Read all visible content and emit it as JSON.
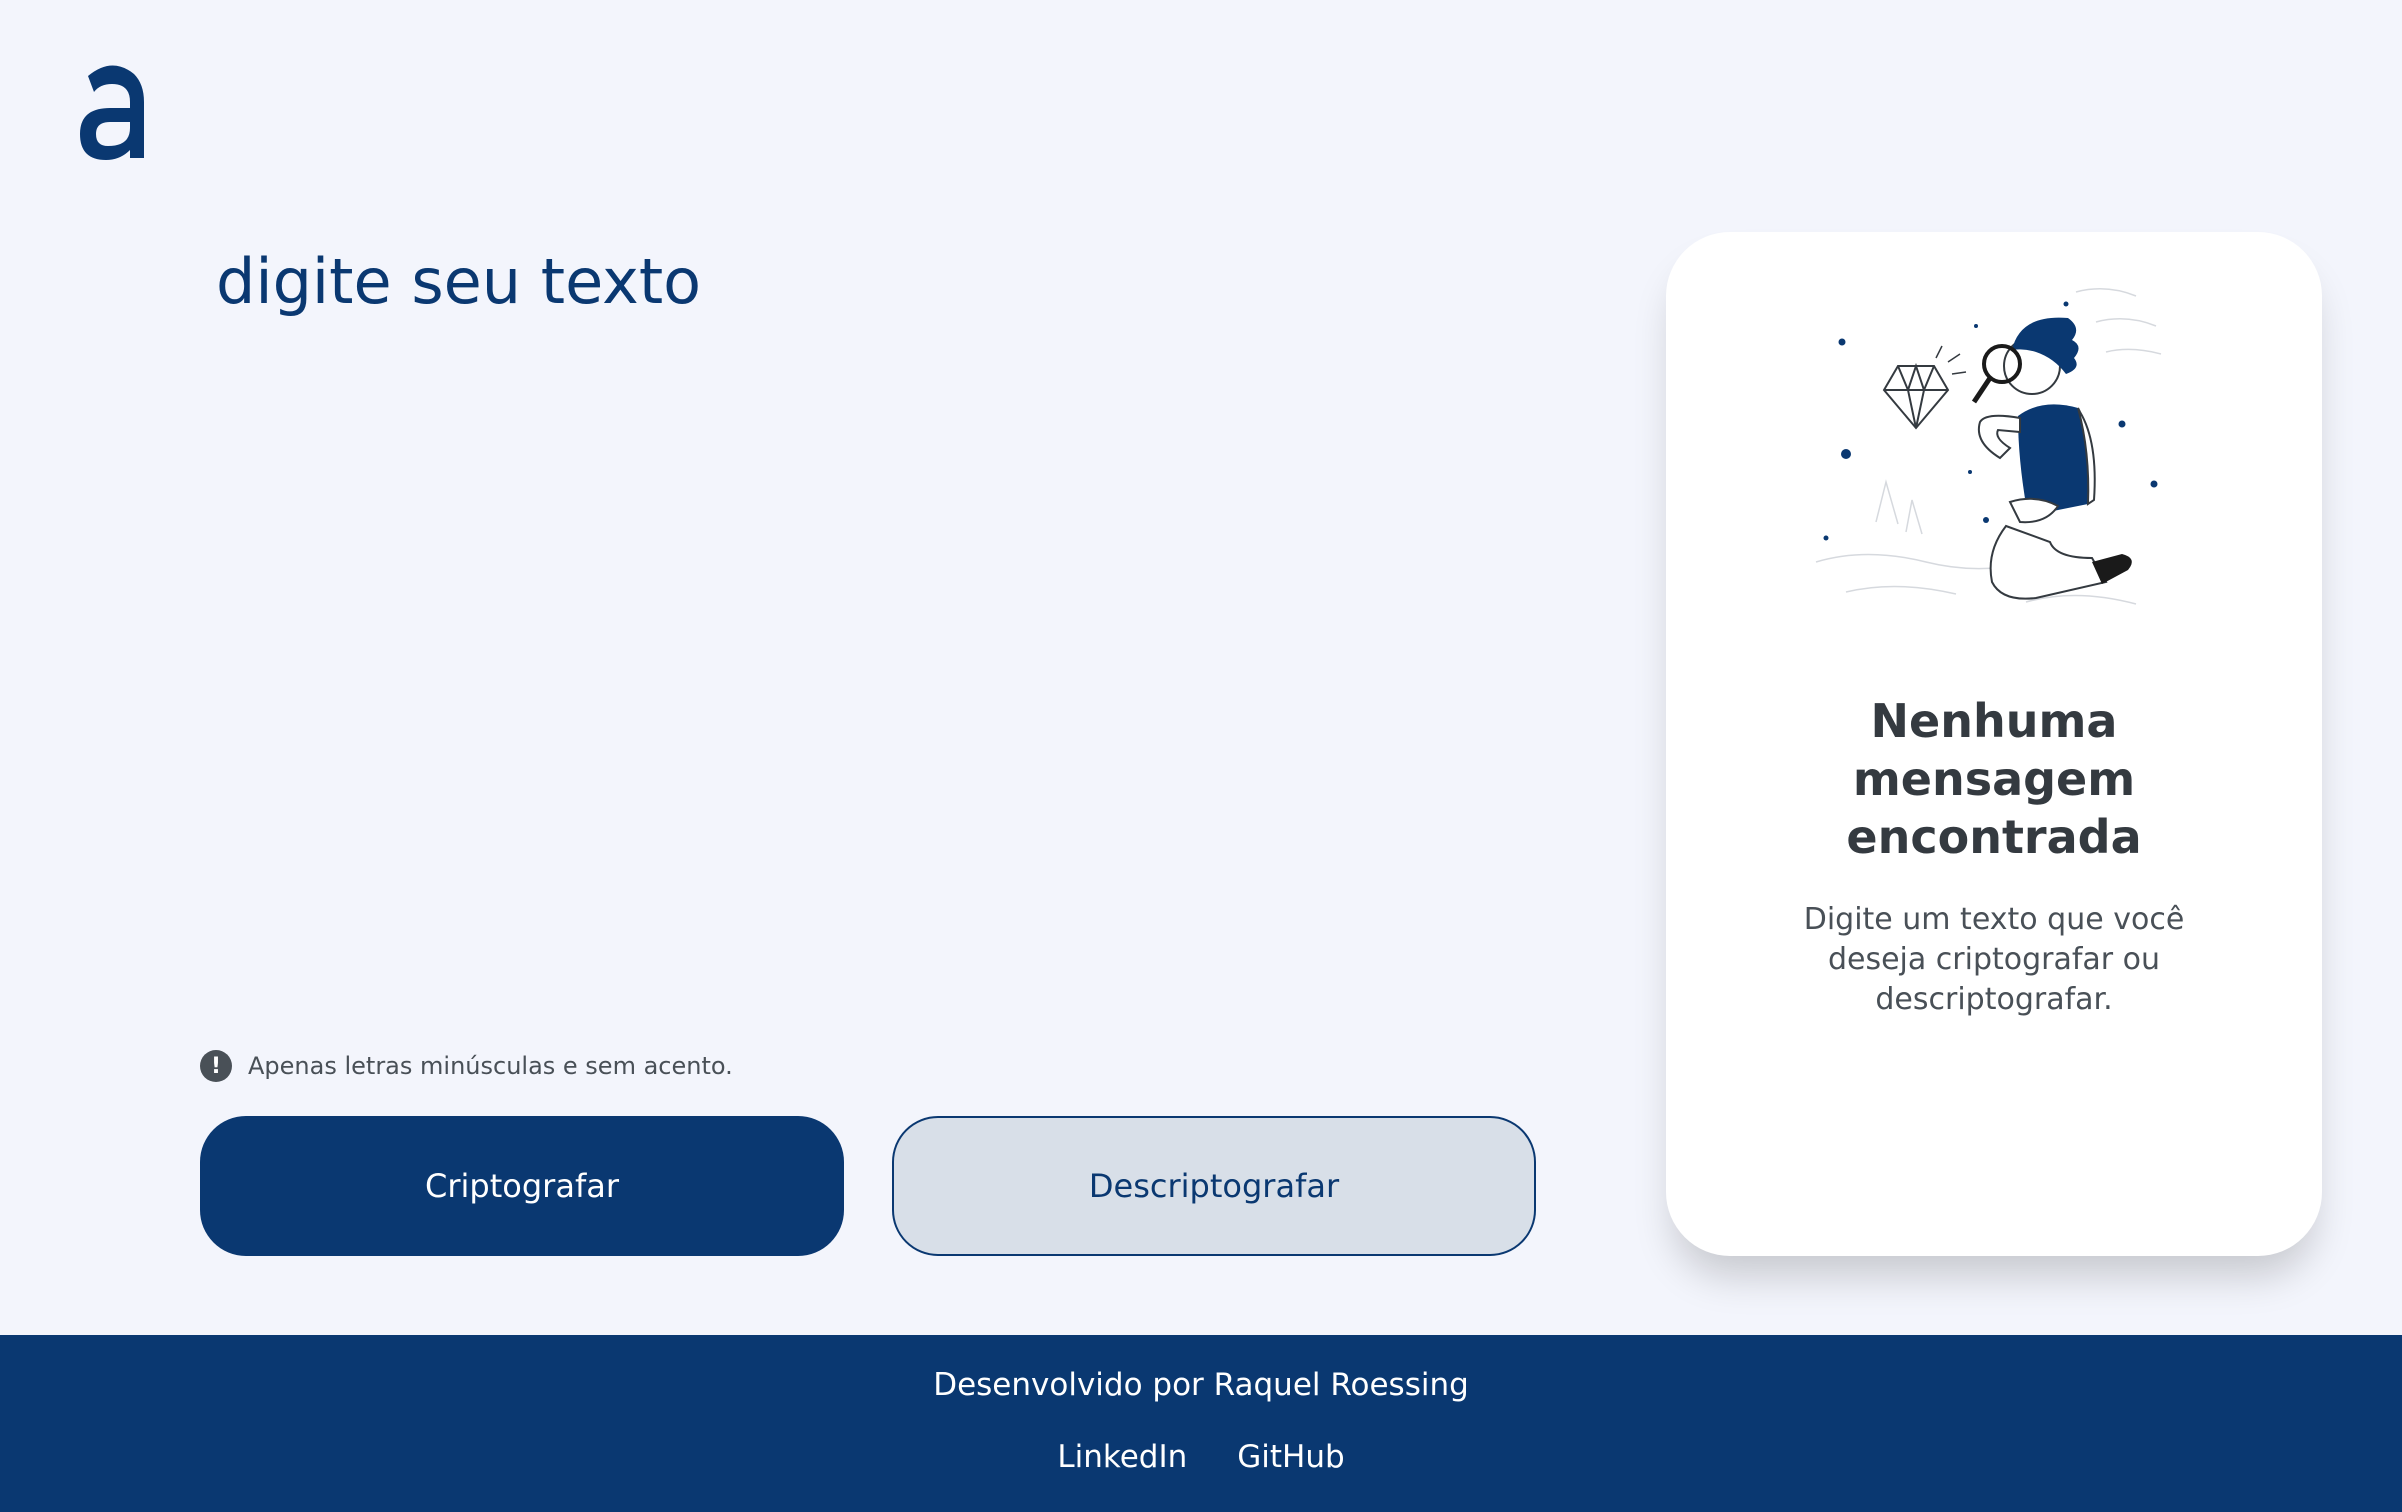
{
  "brand": {
    "logo_letter": "a",
    "logo_icon": "alura-logo-icon",
    "color": "#0a3871"
  },
  "input": {
    "placeholder": "digite seu texto",
    "value": ""
  },
  "hint": {
    "icon": "exclamation-circle-icon",
    "text": "Apenas letras minúsculas e sem acento."
  },
  "buttons": {
    "encrypt": "Criptografar",
    "decrypt": "Descriptografar"
  },
  "output": {
    "illustration": "person-with-magnifying-glass-illustration",
    "title": "Nenhuma mensagem encontrada",
    "description": "Digite um texto que você deseja criptografar ou descriptografar."
  },
  "footer": {
    "credit": "Desenvolvido por Raquel Roessing",
    "links": [
      "LinkedIn",
      "GitHub"
    ]
  },
  "colors": {
    "background": "#f3f5fc",
    "primary": "#0a3871",
    "secondary_button": "#d8dfe8",
    "card": "#ffffff",
    "heading_text": "#343a40",
    "body_text": "#495057"
  }
}
